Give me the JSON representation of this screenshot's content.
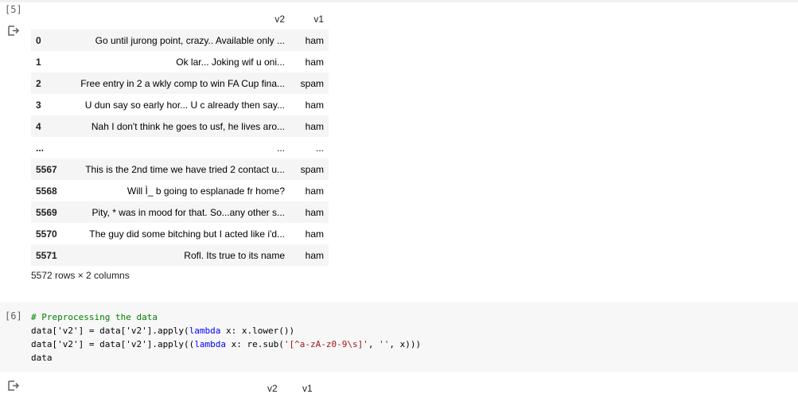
{
  "cell5": {
    "prompt": "[5]",
    "columns": [
      "v2",
      "v1"
    ],
    "rows": [
      {
        "index": "0",
        "v2": "Go until jurong point, crazy.. Available only ...",
        "v1": "ham"
      },
      {
        "index": "1",
        "v2": "Ok lar... Joking wif u oni...",
        "v1": "ham"
      },
      {
        "index": "2",
        "v2": "Free entry in 2 a wkly comp to win FA Cup fina...",
        "v1": "spam"
      },
      {
        "index": "3",
        "v2": "U dun say so early hor... U c already then say...",
        "v1": "ham"
      },
      {
        "index": "4",
        "v2": "Nah I don't think he goes to usf, he lives aro...",
        "v1": "ham"
      },
      {
        "index": "...",
        "v2": "...",
        "v1": "..."
      },
      {
        "index": "5567",
        "v2": "This is the 2nd time we have tried 2 contact u...",
        "v1": "spam"
      },
      {
        "index": "5568",
        "v2": "Will Ì_ b going to esplanade fr home?",
        "v1": "ham"
      },
      {
        "index": "5569",
        "v2": "Pity, * was in mood for that. So...any other s...",
        "v1": "ham"
      },
      {
        "index": "5570",
        "v2": "The guy did some bitching but I acted like i'd...",
        "v1": "ham"
      },
      {
        "index": "5571",
        "v2": "Rofl. Its true to its name",
        "v1": "ham"
      }
    ],
    "shape_text": "5572 rows × 2 columns"
  },
  "cell6": {
    "prompt": "[6]",
    "code": {
      "comment": "# Preprocessing the data",
      "line2_a": "data['v2'] = data['v2'].apply(",
      "line2_kw": "lambda",
      "line2_b": " x: x.lower())",
      "line3_a": "data['v2'] = data['v2'].apply((",
      "line3_kw": "lambda",
      "line3_b": " x: re.sub(",
      "line3_str1": "'[^a-zA-z0-9\\s]'",
      "line3_c": ", ",
      "line3_str2": "''",
      "line3_d": ", x)))",
      "line4": "data"
    },
    "output_columns": [
      "v2",
      "v1"
    ]
  },
  "icons": {
    "output": "output-arrow-icon"
  }
}
